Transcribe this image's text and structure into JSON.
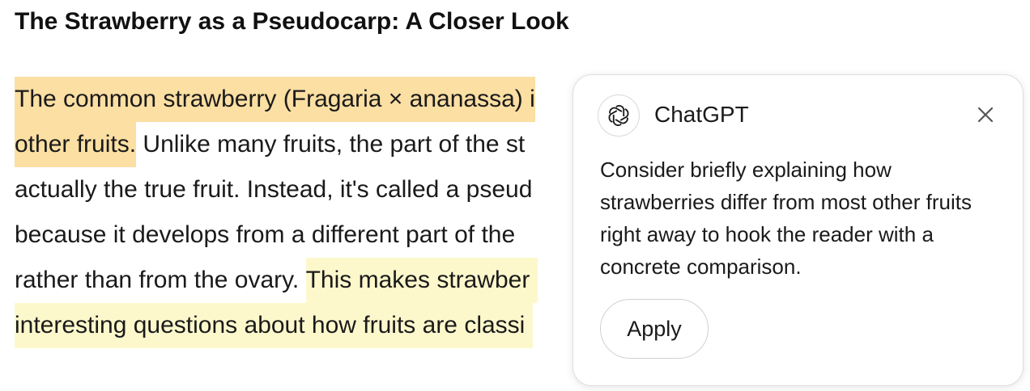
{
  "document": {
    "title": "The Strawberry as a Pseudocarp: A Closer Look",
    "lines": [
      {
        "highlight_orange": "The common strawberry (Fragaria × ananassa) i",
        "plain": "",
        "highlight_yellow": ""
      },
      {
        "highlight_orange": "other fruits.",
        "plain": " Unlike many fruits, the part of the st",
        "highlight_yellow": ""
      },
      {
        "highlight_orange": "",
        "plain": "actually the true fruit. Instead, it's called a pseud",
        "highlight_yellow": ""
      },
      {
        "highlight_orange": "",
        "plain": "because it develops from a different part of the",
        "highlight_yellow": ""
      },
      {
        "highlight_orange": "",
        "plain": "rather than from the ovary. ",
        "highlight_yellow": "This makes strawber"
      },
      {
        "highlight_orange": "",
        "plain": "",
        "highlight_yellow": "interesting questions about how fruits are classi"
      }
    ]
  },
  "popup": {
    "title": "ChatGPT",
    "logo_icon": "openai-logo-icon",
    "close_icon": "close-icon",
    "suggestion": "Consider briefly explaining how strawberries differ from most other fruits right away to hook the reader with a concrete comparison.",
    "apply_label": "Apply"
  },
  "colors": {
    "highlight_orange": "#fbdfa3",
    "highlight_yellow": "#fdf8cc"
  }
}
